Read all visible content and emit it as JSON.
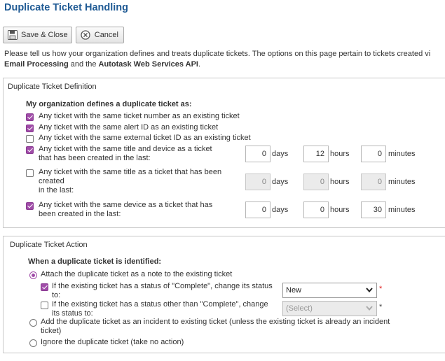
{
  "page": {
    "title": "Duplicate Ticket Handling"
  },
  "toolbar": {
    "save_label": "Save & Close",
    "cancel_label": "Cancel"
  },
  "intro": {
    "line1": "Please tell us how your organization defines and treats duplicate tickets. The options on this page pertain to tickets created vi",
    "line2_a": "Email Processing",
    "line2_b": " and the ",
    "line2_c": "Autotask Web Services API",
    "line2_d": "."
  },
  "definition": {
    "section_title": "Duplicate Ticket Definition",
    "subhead": "My organization defines a duplicate ticket as:",
    "options": [
      {
        "label": "Any ticket with the same ticket number as an existing ticket",
        "checked": true
      },
      {
        "label": "Any ticket with the same alert ID as an existing ticket",
        "checked": true
      },
      {
        "label": "Any ticket with the same external ticket ID as an existing ticket",
        "checked": false
      },
      {
        "label_1": "Any ticket with the same title and device as a ticket",
        "label_2": "that has been created in the last:",
        "checked": true,
        "days": "0",
        "hours": "12",
        "minutes": "0",
        "disabled": false
      },
      {
        "label_1": "Any ticket with the same title as a ticket that has been",
        "label_2": "created",
        "label_3": "in the last:",
        "checked": false,
        "days": "0",
        "hours": "0",
        "minutes": "0",
        "disabled": true
      },
      {
        "label_1": "Any ticket with the same device as a ticket that has",
        "label_2": "been created in the last:",
        "checked": true,
        "days": "0",
        "hours": "0",
        "minutes": "30",
        "disabled": false
      }
    ],
    "units": {
      "days": "days",
      "hours": "hours",
      "minutes": "minutes"
    }
  },
  "action": {
    "section_title": "Duplicate Ticket Action",
    "subhead": "When a duplicate ticket is identified:",
    "attach_label": "Attach the duplicate ticket as a note to the existing ticket",
    "complete_label_1": "If the existing ticket has a status of \"Complete\", change its status",
    "complete_label_2": "to:",
    "complete_value": "New",
    "other_label_1": "If the existing ticket has a status other than \"Complete\", change",
    "other_label_2": "its status to:",
    "other_value": "(Select)",
    "required_mark": "*",
    "incident_label_1": "Add the duplicate ticket as an incident to existing ticket (unless the existing ticket is already an incident",
    "incident_label_2": "ticket)",
    "ignore_label": "Ignore the duplicate ticket (take no action)"
  },
  "colors": {
    "title": "#1f5a94",
    "accent": "#a04ca8",
    "required": "#e02020"
  },
  "icons": {
    "save": "floppy-disk-icon",
    "cancel": "cancel-circle-icon",
    "dropdown": "chevron-down-icon"
  }
}
